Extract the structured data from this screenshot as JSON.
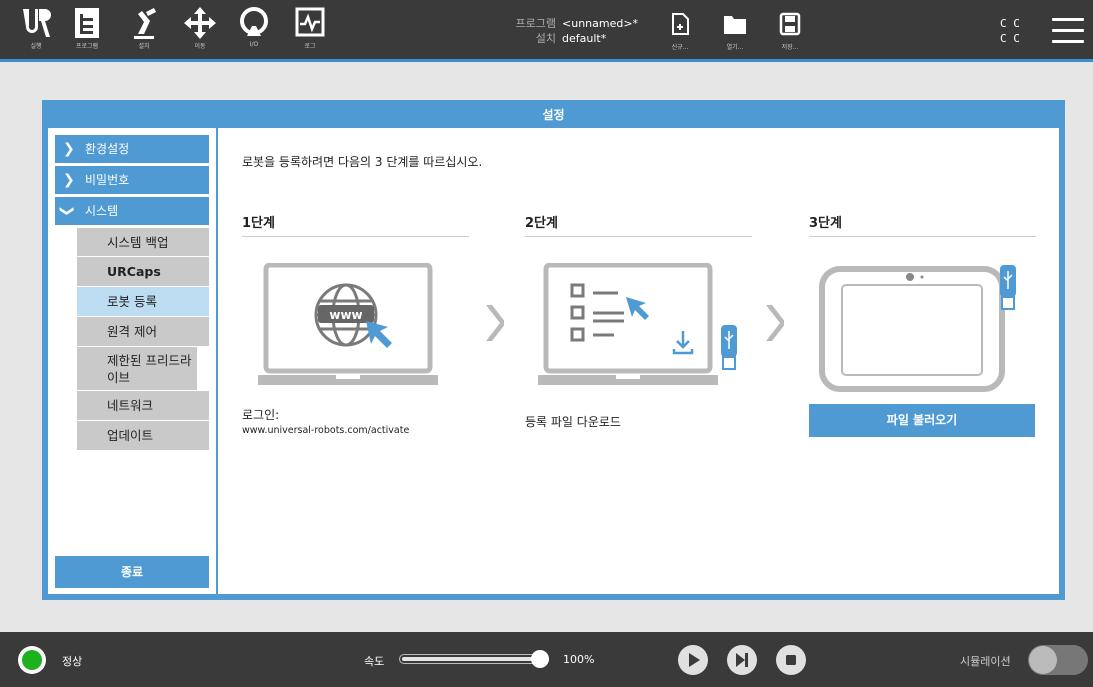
{
  "topbar": {
    "nav": [
      {
        "label": "실행",
        "icon": "ur-logo-icon"
      },
      {
        "label": "프로그램",
        "icon": "program-icon"
      },
      {
        "label": "설치",
        "icon": "robot-arm-icon"
      },
      {
        "label": "이동",
        "icon": "move-arrows-icon"
      },
      {
        "label": "I/O",
        "icon": "io-icon"
      },
      {
        "label": "로그",
        "icon": "log-icon"
      }
    ],
    "program_key": "프로그램",
    "program_value": "<unnamed>*",
    "install_key": "설치",
    "install_value": "default*",
    "file_buttons": [
      {
        "label": "신규...",
        "icon": "new-file-icon"
      },
      {
        "label": "열기...",
        "icon": "open-folder-icon"
      },
      {
        "label": "저장...",
        "icon": "save-icon"
      }
    ],
    "cc_line1": "C C",
    "cc_line2": "C C"
  },
  "dialog": {
    "title": "설정",
    "sidebar": {
      "main_items": [
        "환경설정",
        "비밀번호",
        "시스템"
      ],
      "sub_items": [
        "시스템 백업",
        "URCaps",
        "로봇 등록",
        "원격 제어",
        "제한된 프리드라이브",
        "네트워크",
        "업데이트"
      ],
      "active_sub": "로봇 등록",
      "exit_label": "종료"
    },
    "content": {
      "intro": "로봇을 등록하려면 다음의 3 단계를 따르십시오.",
      "step1_title": "1단계",
      "step2_title": "2단계",
      "step3_title": "3단계",
      "step1_caption": "로그인:",
      "step1_url": "www.universal-robots.com/activate",
      "step1_www": "www",
      "step2_caption": "등록 파일 다운로드",
      "load_button": "파일 불러오기"
    }
  },
  "bottombar": {
    "status": "정상",
    "speed_label": "속도",
    "speed_value": "100%",
    "speed_fraction": 1.0,
    "simulation_label": "시뮬레이션"
  },
  "colors": {
    "accent": "#4f9ad3",
    "topbar": "#3a3a3a",
    "status_ok": "#1db11d"
  }
}
